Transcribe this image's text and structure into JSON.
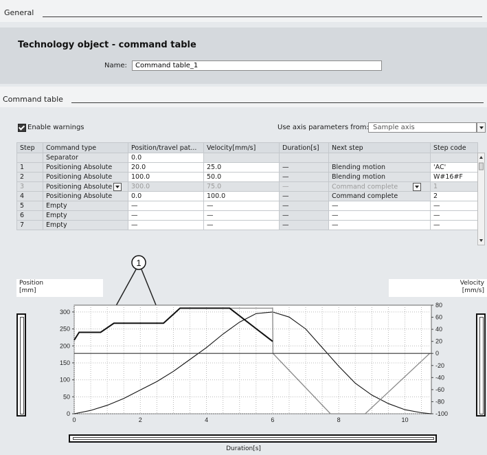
{
  "general": {
    "header": "General"
  },
  "tech": {
    "title": "Technology object - command table",
    "name_label": "Name:",
    "name_value": "Command table_1"
  },
  "cmd_section": {
    "header": "Command table"
  },
  "options": {
    "enable_warnings": "Enable warnings",
    "use_axis_label": "Use axis parameters from:",
    "use_axis_value": "Sample axis"
  },
  "table": {
    "headers": [
      "Step",
      "Command type",
      "Position/travel pat...",
      "Velocity[mm/s]",
      "Duration[s]",
      "Next step",
      "Step code"
    ],
    "rows": [
      [
        "",
        "Separator",
        "0.0",
        "",
        "",
        "",
        ""
      ],
      [
        "1",
        "Positioning Absolute",
        "20.0",
        "25.0",
        "—",
        "Blending motion",
        "'AC'"
      ],
      [
        "2",
        "Positioning Absolute",
        "100.0",
        "50.0",
        "—",
        "Blending motion",
        "W#16#F"
      ],
      [
        "3",
        "Positioning Absolute",
        "300.0",
        "75.0",
        "—",
        "Command complete",
        "1"
      ],
      [
        "4",
        "Positioning Absolute",
        "0.0",
        "100.0",
        "—",
        "Command complete",
        "2"
      ],
      [
        "5",
        "Empty",
        "—",
        "—",
        "—",
        "—",
        "—"
      ],
      [
        "6",
        "Empty",
        "—",
        "—",
        "—",
        "—",
        "—"
      ],
      [
        "7",
        "Empty",
        "—",
        "—",
        "—",
        "—",
        "—"
      ]
    ]
  },
  "callout": "1",
  "chart_labels": {
    "position": "Position",
    "position_unit": "[mm]",
    "velocity": "Velocity",
    "velocity_unit": "[mm/s]",
    "duration": "Duration[s]"
  },
  "chart_data": {
    "type": "line",
    "xlabel": "Duration[s]",
    "ylabel": "Position [mm]",
    "y2label": "Velocity [mm/s]",
    "xlim": [
      0,
      10.8
    ],
    "ylim": [
      0,
      320
    ],
    "y2lim": [
      -100,
      80
    ],
    "x_ticks": [
      0,
      2,
      4,
      6,
      8,
      10
    ],
    "y_ticks": [
      0,
      50,
      100,
      150,
      200,
      250,
      300
    ],
    "y2_ticks": [
      80,
      60,
      40,
      20,
      0,
      -20,
      -40,
      -60,
      -80,
      -100
    ],
    "grid": true,
    "series": [
      {
        "axis": "left",
        "color": "#111111",
        "x": [
          0,
          0.5,
          1.0,
          1.5,
          2.0,
          2.5,
          3.0,
          3.5,
          4.0,
          4.5,
          5.0,
          5.5,
          6.0,
          6.5,
          7.0,
          7.5,
          8.0,
          8.5,
          9.0,
          9.5,
          10.0,
          10.5,
          10.8
        ],
        "y": [
          0,
          10,
          25,
          45,
          70,
          95,
          125,
          160,
          195,
          235,
          270,
          295,
          300,
          285,
          250,
          195,
          140,
          90,
          55,
          30,
          12,
          3,
          0
        ]
      },
      {
        "axis": "right",
        "color": "#888888",
        "x": [
          0,
          0.15,
          0.8,
          1.2,
          1.75,
          2.7,
          3.2,
          4.7,
          6.0,
          6.01,
          7.75,
          8.8,
          10.75
        ],
        "y": [
          22,
          35,
          35,
          50,
          50,
          50,
          75,
          75,
          75,
          0,
          -100,
          -100,
          0
        ]
      },
      {
        "axis": "right",
        "color": "#111111",
        "x": [
          0,
          0.15,
          0.8,
          1.2,
          1.75,
          2.7,
          3.2,
          4.7,
          6.0
        ],
        "y": [
          22,
          35,
          35,
          50,
          50,
          50,
          75,
          75,
          20
        ]
      },
      {
        "axis": "right",
        "color": "#333333",
        "x": [
          0,
          10.8
        ],
        "y": [
          0,
          0
        ]
      }
    ]
  }
}
